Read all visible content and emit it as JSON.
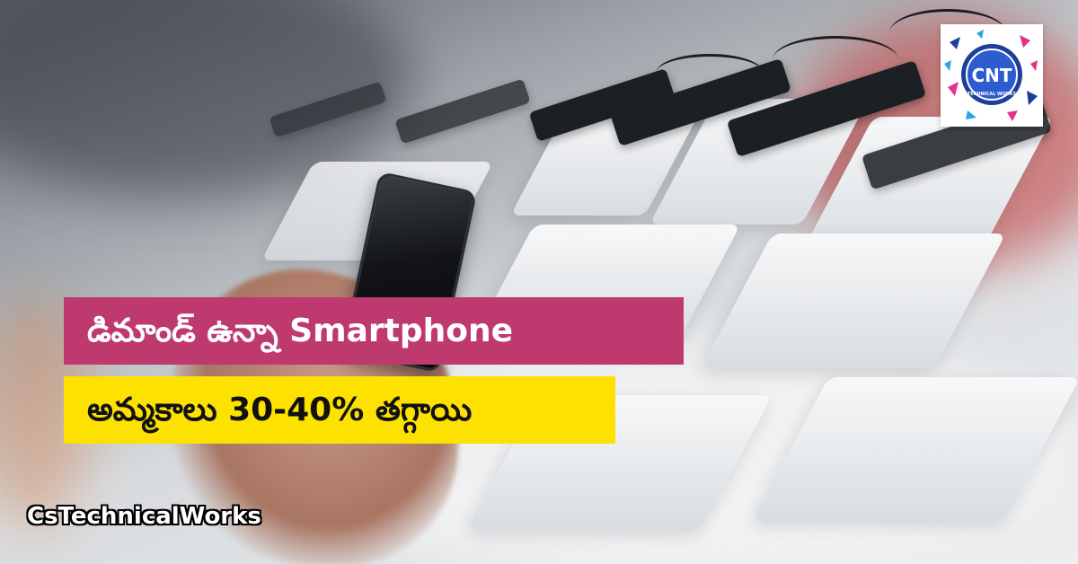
{
  "headline": {
    "line1": "డిమాండ్ ఉన్నా Smartphone",
    "line2": "అమ్మకాలు 30-40% తగ్గాయి"
  },
  "watermark": "CsTechnicalWorks",
  "logo": {
    "monogram": "CNT",
    "caption": "TECHNICAL WORKS"
  },
  "colors": {
    "banner_pink": "#be3a6e",
    "banner_yellow": "#fde100",
    "logo_blue": "#1d3f9a"
  }
}
